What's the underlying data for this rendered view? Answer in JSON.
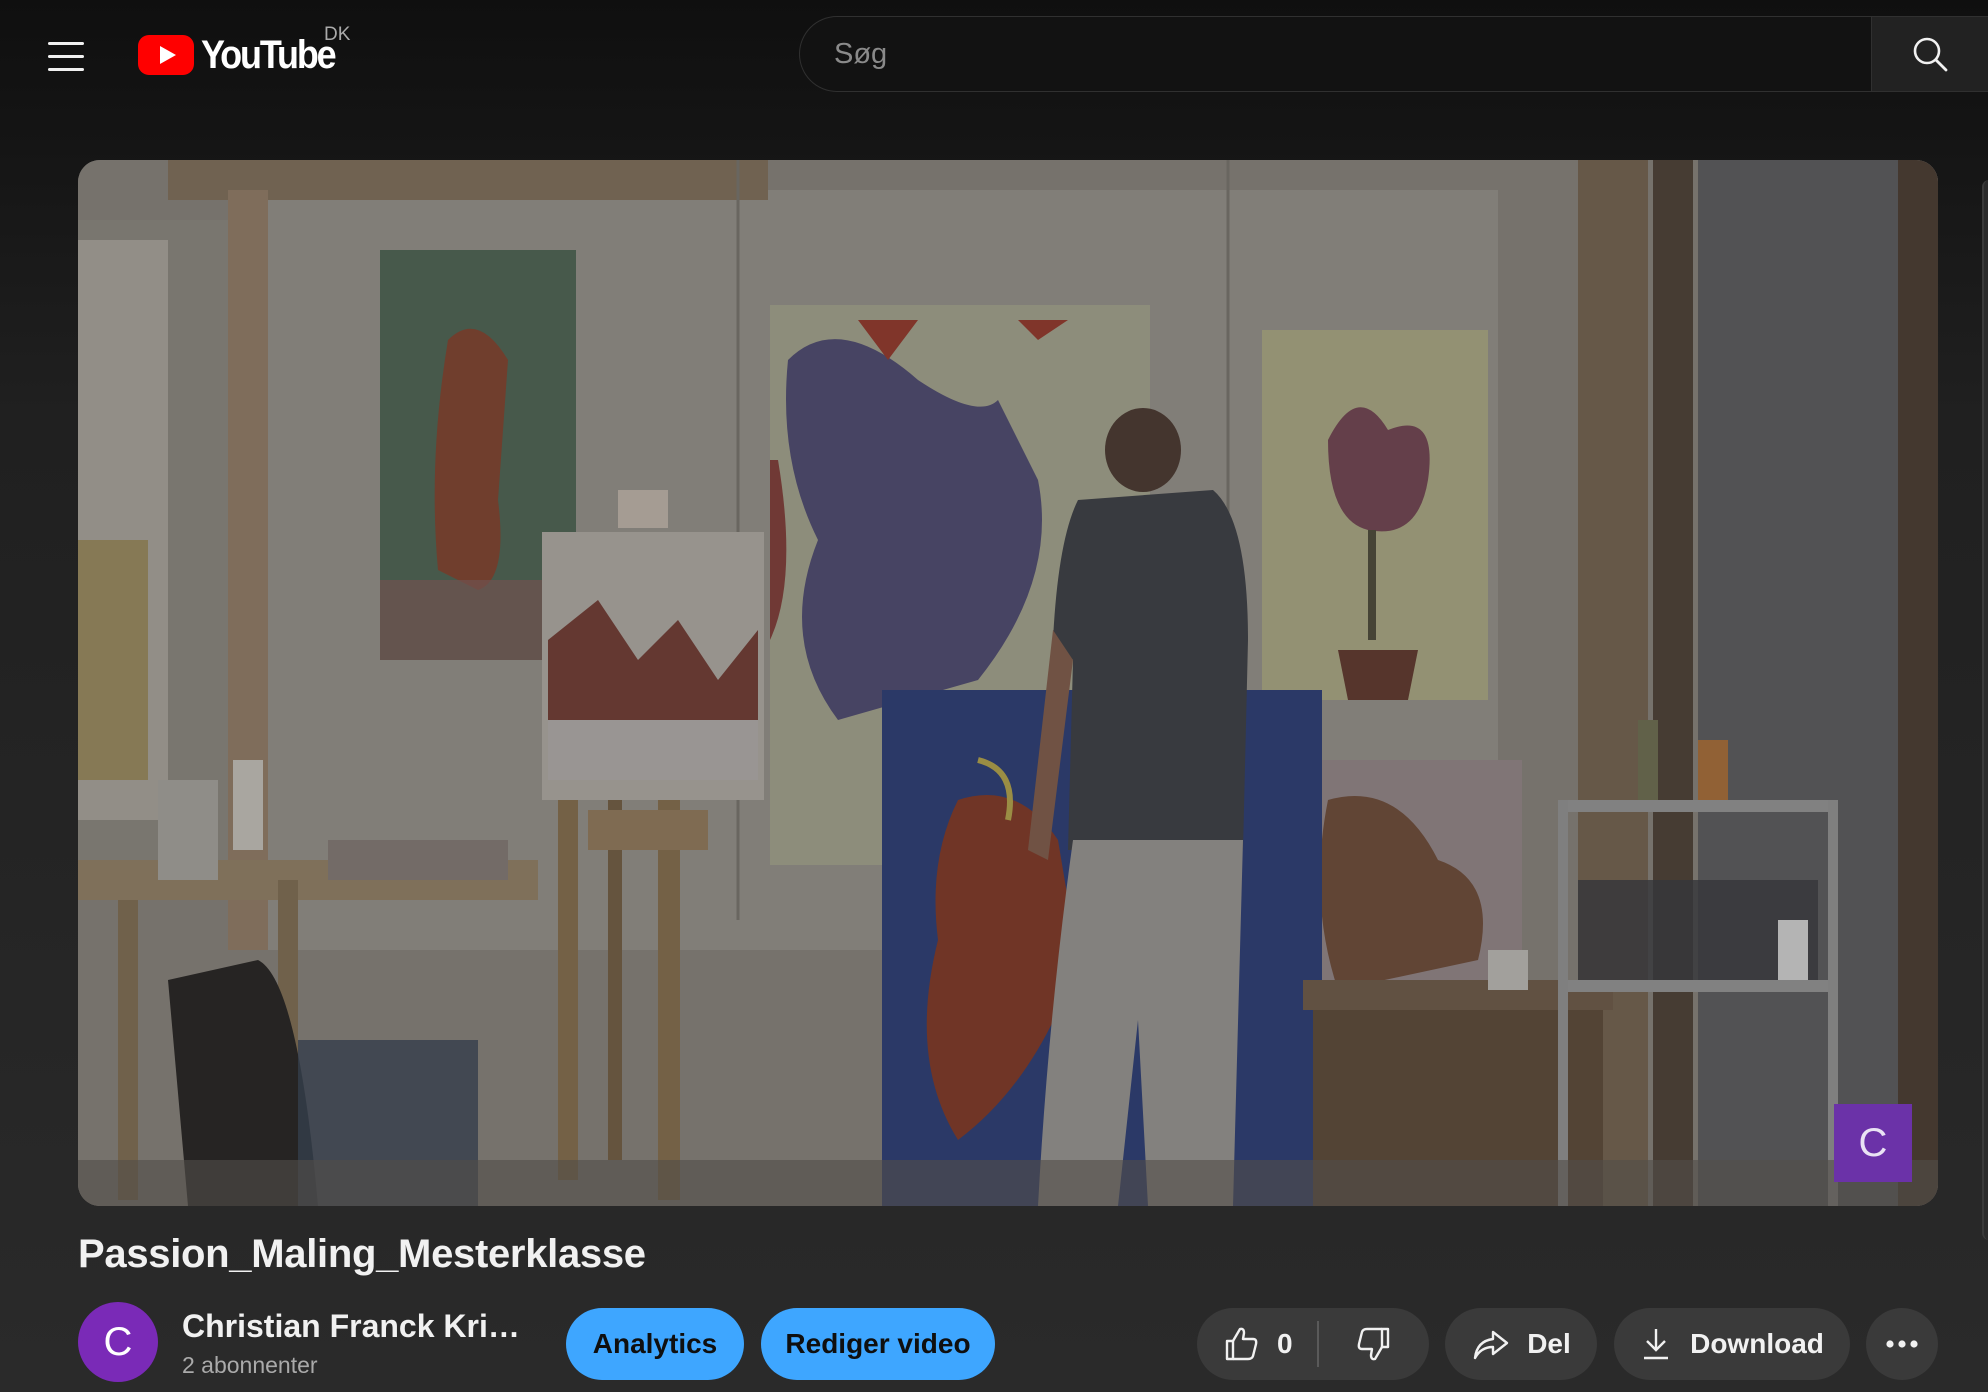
{
  "header": {
    "logo_text": "YouTube",
    "country_code": "DK",
    "search_placeholder": "Søg"
  },
  "video": {
    "watermark_letter": "C",
    "title": "Passion_Maling_Mesterklasse"
  },
  "channel": {
    "avatar_letter": "C",
    "name": "Christian Franck Kristensen",
    "subscribers": "2 abonnenter"
  },
  "actions": {
    "analytics_label": "Analytics",
    "edit_label": "Rediger video",
    "like_count": "0",
    "share_label": "Del",
    "download_label": "Download"
  },
  "colors": {
    "accent_blue": "#3ea6ff",
    "brand_red": "#ff0000",
    "avatar_purple": "#7a2ab7"
  }
}
